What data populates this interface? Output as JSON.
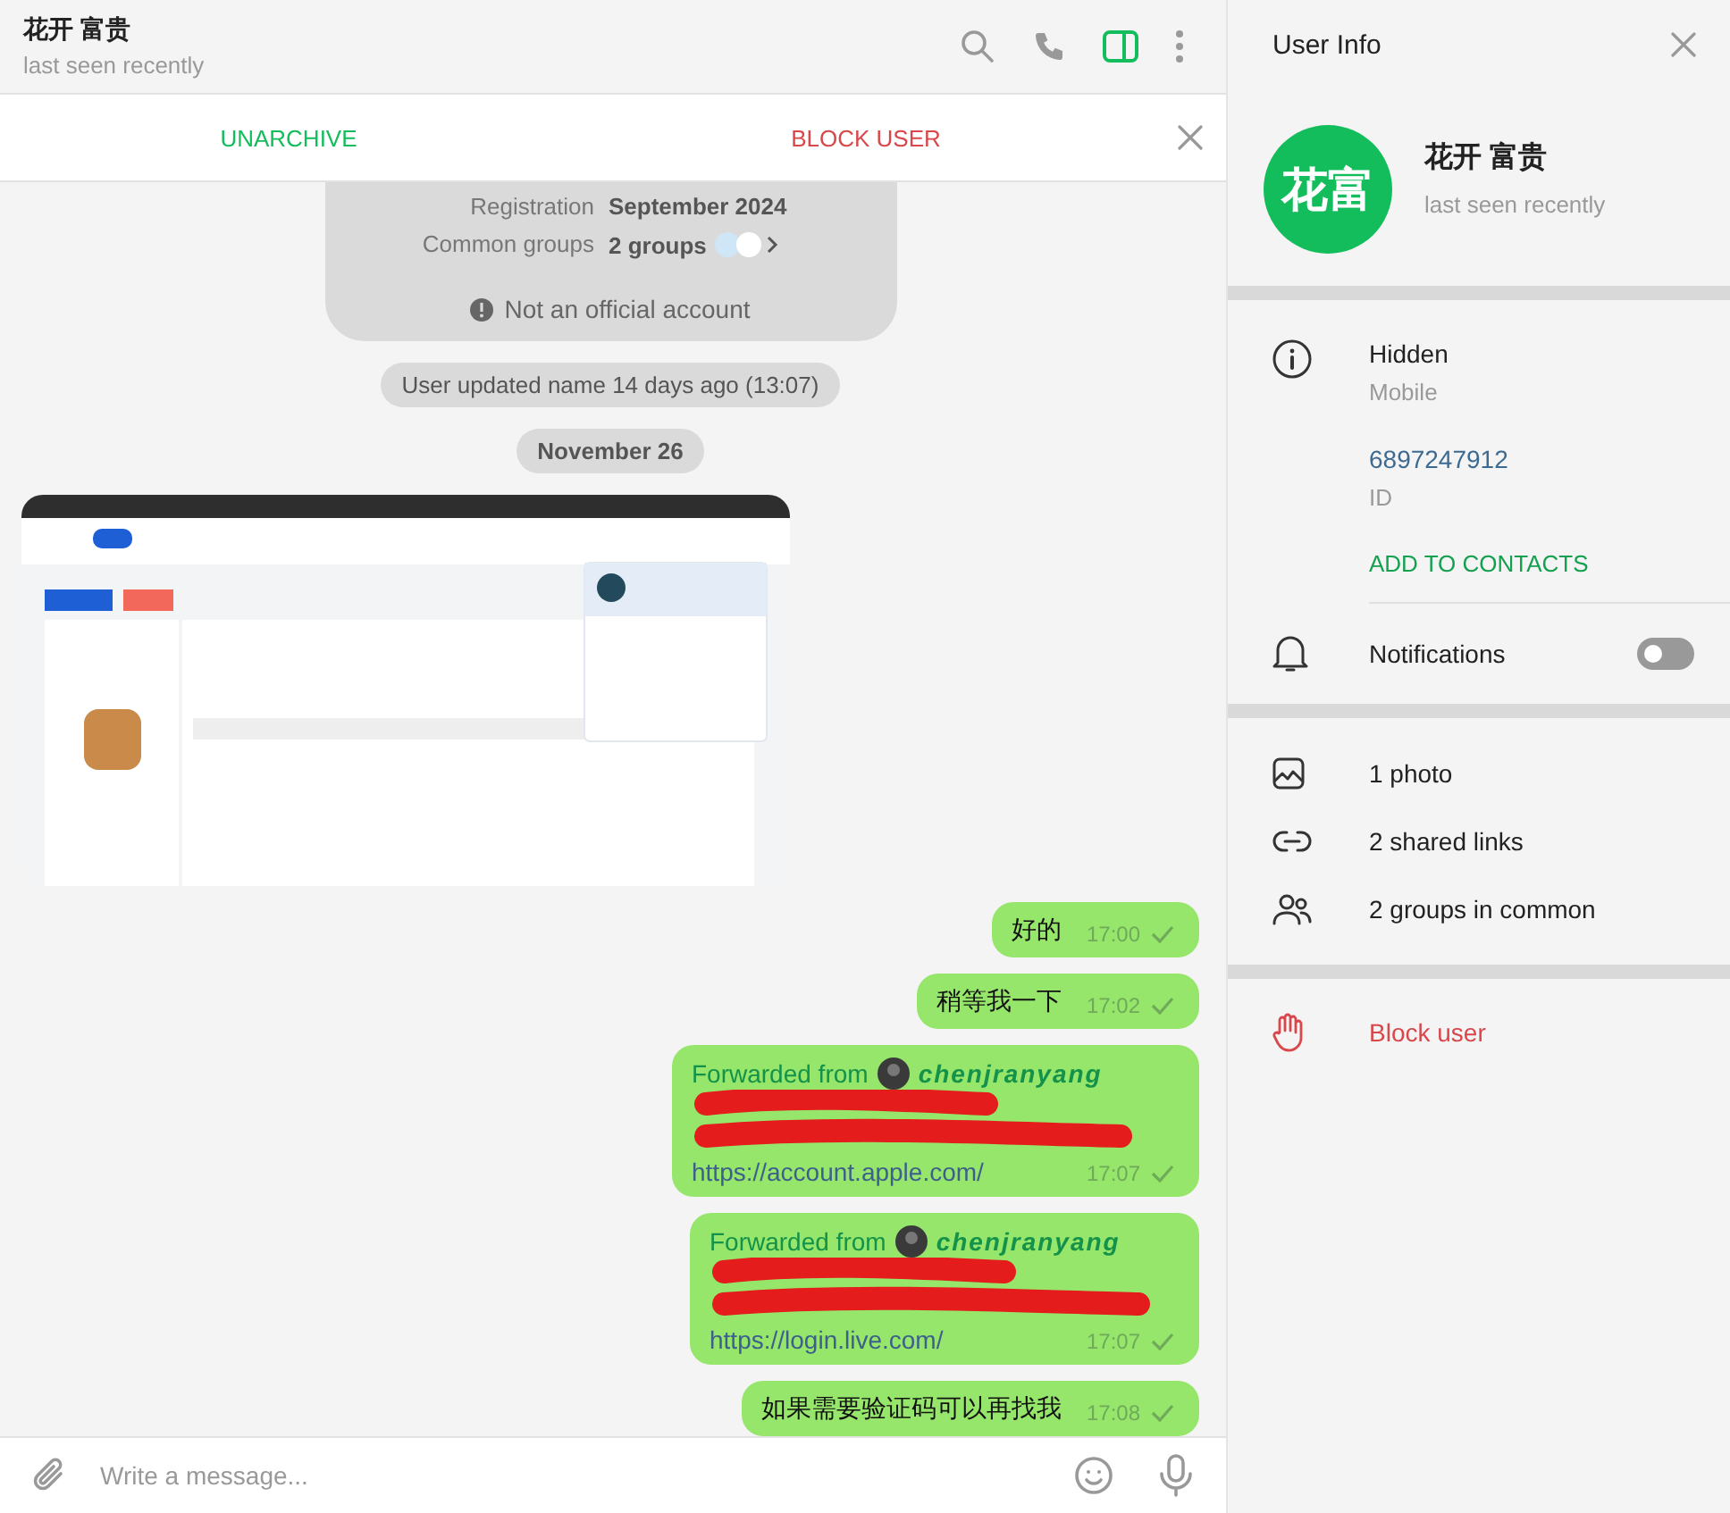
{
  "chat_header": {
    "title": "花开 富贵",
    "status": "last seen recently",
    "info_panel_open": true
  },
  "action_bar": {
    "unarchive": "UNARCHIVE",
    "block": "BLOCK USER"
  },
  "service_card": {
    "rows": [
      {
        "label": "Registration",
        "value": "September 2024"
      },
      {
        "label": "Common groups",
        "value": "2 groups"
      }
    ],
    "notice": "Not an official account"
  },
  "service_messages": [
    {
      "kind": "pill",
      "text": "User updated name 14 days ago (13:07)"
    },
    {
      "kind": "date",
      "text": "November 26"
    }
  ],
  "messages": [
    {
      "kind": "text",
      "text": "好的",
      "time": "17:00"
    },
    {
      "kind": "text",
      "text": "稍等我一下",
      "time": "17:02"
    },
    {
      "kind": "forwarded",
      "forwarded_label": "Forwarded from",
      "forwarded_name": "chenjranyang",
      "redacted": true,
      "link": "https://account.apple.com/",
      "time": "17:07"
    },
    {
      "kind": "forwarded",
      "forwarded_label": "Forwarded from",
      "forwarded_name": "chenjranyang",
      "redacted": true,
      "link": "https://login.live.com/",
      "time": "17:07"
    },
    {
      "kind": "text",
      "text": "如果需要验证码可以再找我",
      "time": "17:08"
    }
  ],
  "composer": {
    "placeholder": "Write a message..."
  },
  "user_info": {
    "title": "User Info",
    "avatar_initials": "花富",
    "name": "花开 富贵",
    "status": "last seen recently",
    "details": [
      {
        "value": "Hidden",
        "label": "Mobile"
      },
      {
        "value": "6897247912",
        "label": "ID"
      }
    ],
    "add_contact": "ADD TO CONTACTS",
    "notifications": {
      "label": "Notifications",
      "on": false
    },
    "media": [
      {
        "text": "1 photo"
      },
      {
        "kind": "link",
        "text": "2 shared links"
      },
      {
        "kind": "groups",
        "text": "2 groups in common"
      }
    ],
    "block": "Block user"
  }
}
